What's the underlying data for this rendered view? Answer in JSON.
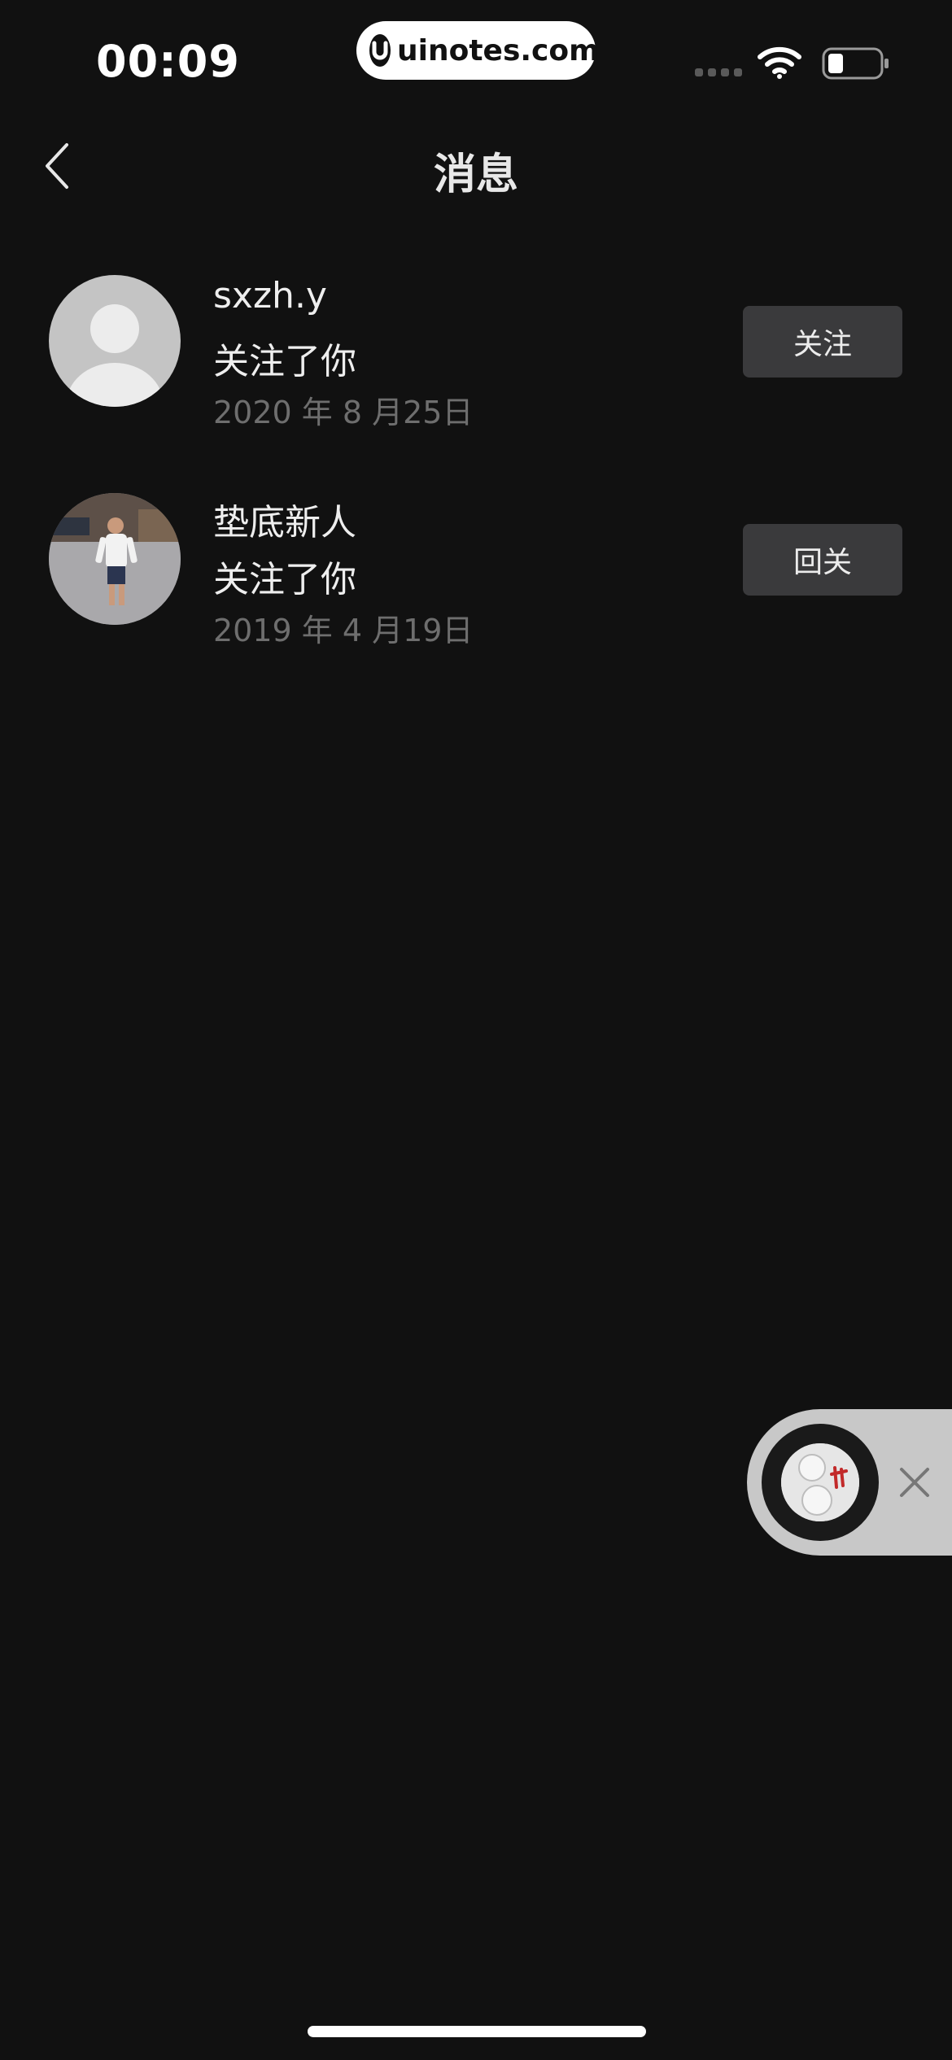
{
  "status_bar": {
    "time": "00:09",
    "watermark": "uinotes.com"
  },
  "nav": {
    "title": "消息"
  },
  "notifications": [
    {
      "name": "sxzh.y",
      "message": "关注了你",
      "date": "2020 年 8 月25日",
      "action": "关注"
    },
    {
      "name": "垫底新人",
      "message": "关注了你",
      "date": "2019 年 4 月19日",
      "action": "回关"
    }
  ],
  "icons": {
    "back": "chevron-left-icon",
    "close": "close-icon",
    "wifi": "wifi-icon",
    "battery": "battery-icon"
  },
  "colors": {
    "background": "#111111",
    "button": "#3a3a3c",
    "date_text": "#6e6e6e"
  }
}
